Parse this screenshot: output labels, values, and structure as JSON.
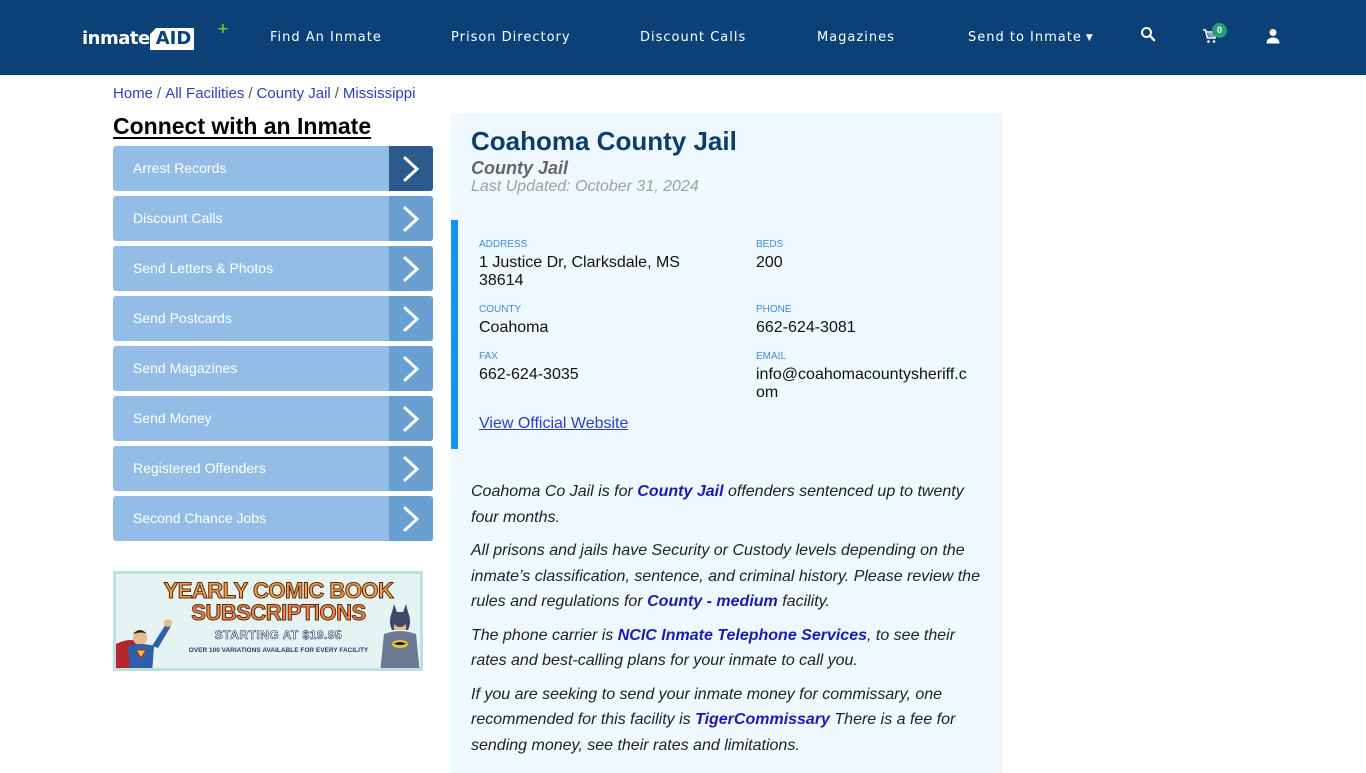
{
  "navbar": {
    "logo_text": "inmate",
    "logo_accent": "AID",
    "items": [
      {
        "label": "Find An Inmate"
      },
      {
        "label": "Prison Directory"
      },
      {
        "label": "Discount Calls"
      },
      {
        "label": "Magazines"
      },
      {
        "label": "Send to Inmate",
        "has_dropdown": true
      }
    ],
    "cart_count": "0",
    "icons": [
      "search-icon",
      "cart-icon",
      "user-icon"
    ]
  },
  "breadcrumb": [
    {
      "label": "Home"
    },
    {
      "label": "All Facilities"
    },
    {
      "label": "County Jail"
    },
    {
      "label": "Mississippi"
    }
  ],
  "breadcrumb_separator": "/",
  "sidebar": {
    "title": "Connect with an Inmate",
    "items": [
      {
        "label": "Arrest Records"
      },
      {
        "label": "Discount Calls"
      },
      {
        "label": "Send Letters & Photos"
      },
      {
        "label": "Send Postcards"
      },
      {
        "label": "Send Magazines"
      },
      {
        "label": "Send Money"
      },
      {
        "label": "Registered Offenders"
      },
      {
        "label": "Second Chance Jobs"
      }
    ],
    "ad": {
      "line1": "YEARLY COMIC BOOK",
      "line2": "SUBSCRIPTIONS",
      "line3": "STARTING AT $19.95",
      "line4": "OVER 100 VARIATIONS AVAILABLE FOR EVERY FACILITY"
    }
  },
  "facility": {
    "name": "Coahoma County Jail",
    "type": "County Jail",
    "last_updated": "Last Updated: October 31, 2024",
    "fields": {
      "address": {
        "label": "Address",
        "value": "1 Justice Dr, Clarksdale, MS 38614"
      },
      "beds": {
        "label": "Beds",
        "value": "200"
      },
      "county": {
        "label": "County",
        "value": "Coahoma"
      },
      "phone": {
        "label": "Phone",
        "value": "662-624-3081"
      },
      "fax": {
        "label": "Fax",
        "value": "662-624-3035"
      },
      "email": {
        "label": "Email",
        "value": "info@coahomacountysheriff.com"
      }
    },
    "website_link": "View Official Website"
  },
  "description": {
    "p1": {
      "before": "Coahoma Co Jail is for ",
      "link": "County Jail",
      "after": " offenders sentenced up to twenty four months."
    },
    "p2": {
      "before": "All prisons and jails have Security or Custody levels depending on the inmate’s classification, sentence, and criminal history. Please review the rules and regulations for ",
      "link": "County - medium",
      "after": " facility."
    },
    "p3": {
      "before": "The phone carrier is ",
      "link": "NCIC Inmate Telephone Services",
      "after": ", to see their rates and best-calling plans for your inmate to call you."
    },
    "p4": {
      "before": "If you are seeking to send your inmate money for commissary, one recommended for this facility is ",
      "link": "TigerCommissary",
      "after": " There is a fee for sending money, see their rates and limitations."
    }
  },
  "colors": {
    "navbar": "#0b4176",
    "panel_bg": "#eff8fe",
    "accent_bar": "#1493f0",
    "title": "#0d3d6e",
    "link": "#1a1ab8",
    "side_item": "#93bde6",
    "side_chevron": "#699fd1",
    "side_chevron_active": "#2d5a8c"
  }
}
